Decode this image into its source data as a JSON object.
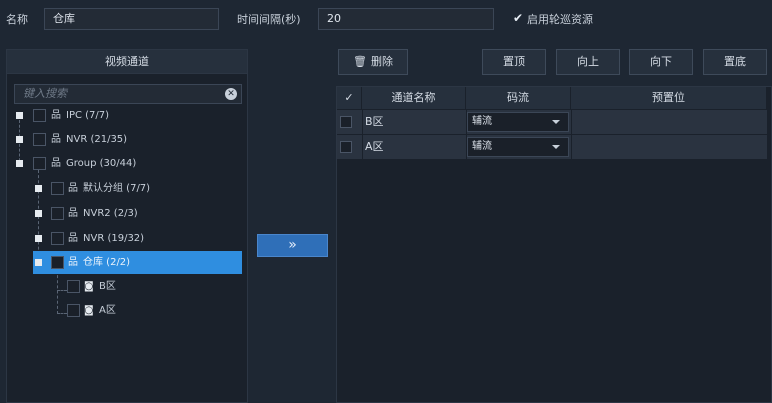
{
  "form": {
    "name_label": "名称",
    "name_value": "仓库",
    "interval_label": "时间间隔(秒)",
    "interval_value": "20",
    "rotate_label": "启用轮巡资源",
    "rotate_checked": true
  },
  "left_panel": {
    "title": "视频通道",
    "search_placeholder": "键入搜索",
    "tree": [
      {
        "label": "IPC (7/7)",
        "icon": "network-icon"
      },
      {
        "label": "NVR (21/35)",
        "icon": "network-icon"
      },
      {
        "label": "Group (30/44)",
        "icon": "network-icon"
      },
      {
        "label": "默认分组 (7/7)",
        "icon": "network-icon"
      },
      {
        "label": "NVR2 (2/3)",
        "icon": "network-icon"
      },
      {
        "label": "NVR (19/32)",
        "icon": "network-icon"
      },
      {
        "label": "仓库 (2/2)",
        "icon": "network-icon",
        "selected": true
      },
      {
        "label": "B区",
        "icon": "camera-icon"
      },
      {
        "label": "A区",
        "icon": "camera-icon"
      }
    ]
  },
  "transfer_button": "»",
  "toolbar": {
    "delete_label": "删除",
    "top_label": "置顶",
    "up_label": "向上",
    "down_label": "向下",
    "bottom_label": "置底"
  },
  "table": {
    "columns": [
      "✓",
      "通道名称",
      "码流",
      "预置位"
    ],
    "rows": [
      {
        "name": "B区",
        "stream": "辅流",
        "preset": ""
      },
      {
        "name": "A区",
        "stream": "辅流",
        "preset": ""
      }
    ]
  },
  "colors": {
    "background": "#1e2733",
    "selected": "#2f8ee0",
    "accent_button": "#2f6fb8"
  }
}
